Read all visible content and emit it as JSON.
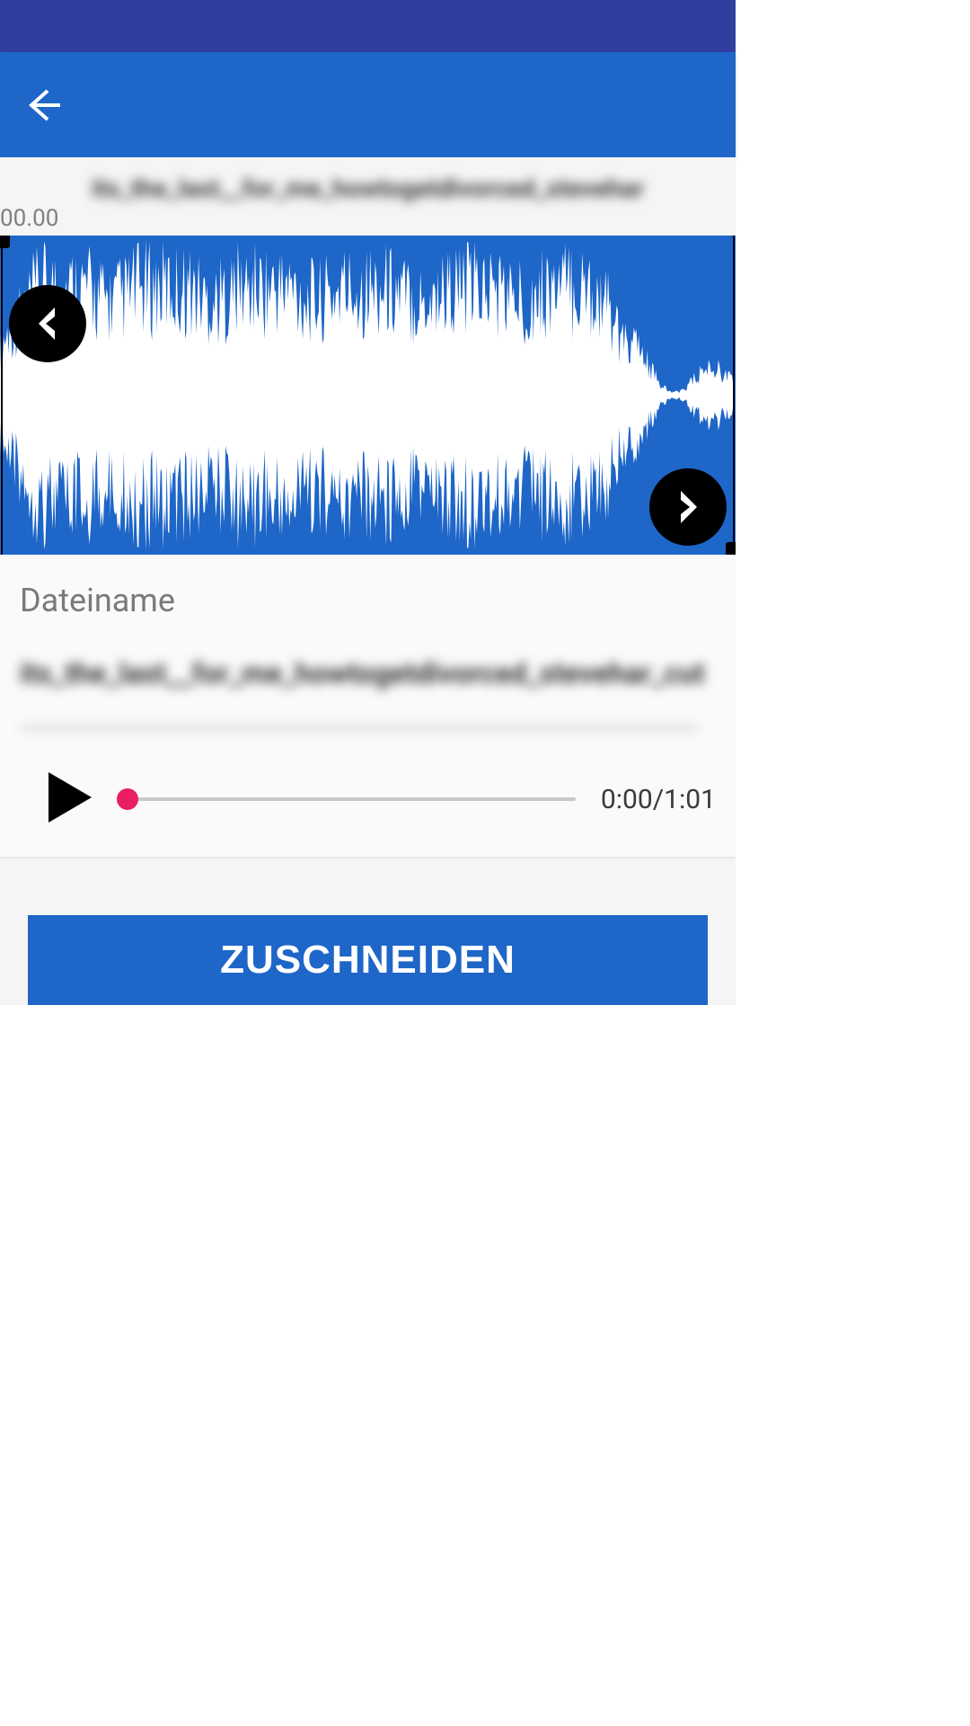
{
  "track_title": "its_the_last__for_me_howtogetdivorced_stevehar",
  "timeline": {
    "start": "00.00"
  },
  "filename": {
    "label": "Dateiname",
    "value": "its_the_last__for_me_howtogetdivorced_stevehar_cut"
  },
  "player": {
    "time_display": "0:00/1:01",
    "progress_percent": 2
  },
  "actions": {
    "crop_label": "ZUSCHNEIDEN"
  },
  "colors": {
    "primary": "#1E66C8",
    "primary_dark": "#303F9F",
    "accent": "#E91E63"
  }
}
